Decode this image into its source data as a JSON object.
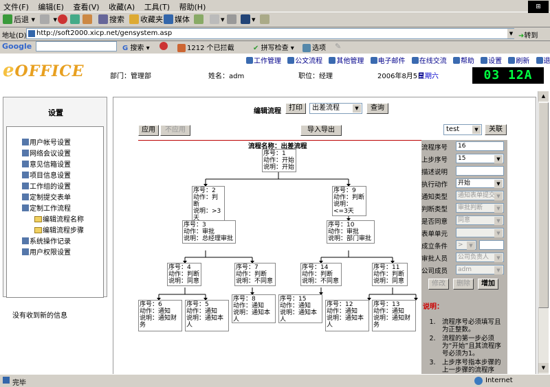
{
  "menu": {
    "items": [
      "文件(F)",
      "编辑(E)",
      "查看(V)",
      "收藏(A)",
      "工具(T)",
      "帮助(H)"
    ]
  },
  "toolbar": {
    "back": "后退",
    "search": "搜索",
    "favorites": "收藏夹",
    "media": "媒体"
  },
  "address": {
    "label": "地址(D)",
    "url": "http://soft2000.xicp.net/gensystem.asp",
    "go": "转到"
  },
  "google": {
    "label": "Google",
    "search": "搜索",
    "blocked": "1212 个已拦截",
    "spell": "拼写检查",
    "options": "选项"
  },
  "app": {
    "logo": "OFFICE",
    "nav": [
      "工作管理",
      "公文流程",
      "其他管理",
      "电子邮件",
      "在线交流",
      "帮助",
      "设置",
      "刷新",
      "退出"
    ],
    "dept": "部门：管理部",
    "name": "姓名：adm",
    "position": "职位：经理",
    "date": "2006年8月5日",
    "weekday": "星期六",
    "clock": "03 12A"
  },
  "sidebar": {
    "title": "设置",
    "items": [
      "用户帐号设置",
      "网络会议设置",
      "意见信箱设置",
      "项目信息设置",
      "工作组的设置",
      "定制提交表单",
      "定制工作流程",
      "编辑流程名称",
      "编辑流程步骤",
      "系统操作记录",
      "用户权限设置"
    ],
    "message": "没有收到新的信息"
  },
  "main": {
    "edit_label": "编辑流程",
    "print": "打印",
    "flow_select": "出差流程",
    "query": "查询",
    "apply": "应用",
    "unapply": "不应用",
    "import_export": "导入导出",
    "test_select": "test",
    "relate": "关联",
    "flow_title": "流程名称：出差流程"
  },
  "flow": {
    "n1": [
      "序号：1",
      "动作：开始",
      "说明：开始"
    ],
    "n2": [
      "序号：2",
      "动作：判断",
      "说明：>3天"
    ],
    "n9": [
      "序号：9",
      "动作：判断",
      "说明：<=3天"
    ],
    "n3": [
      "序号：3",
      "动作：审批",
      "说明：总经理审批"
    ],
    "n10": [
      "序号：10",
      "动作：审批",
      "说明：部门审批"
    ],
    "n4": [
      "序号：4",
      "动作：判断",
      "说明：同意"
    ],
    "n7": [
      "序号：7",
      "动作：判断",
      "说明：不同意"
    ],
    "n14": [
      "序号：14",
      "动作：判断",
      "说明：不同意"
    ],
    "n11": [
      "序号：11",
      "动作：判断",
      "说明：同意"
    ],
    "n6": [
      "序号：6",
      "动作：通知",
      "说明：通知财务"
    ],
    "n5": [
      "序号：5",
      "动作：通知",
      "说明：通知本人"
    ],
    "n8": [
      "序号：8",
      "动作：通知",
      "说明：通知本人"
    ],
    "n15": [
      "序号：15",
      "动作：通知",
      "说明：通知本人"
    ],
    "n12": [
      "序号：12",
      "动作：通知",
      "说明：通知本人"
    ],
    "n13": [
      "序号：13",
      "动作：通知",
      "说明：通知财务"
    ]
  },
  "panel": {
    "labels": [
      "流程序号",
      "上步序号",
      "描述说明",
      "执行动作",
      "通知类型",
      "判断类型",
      "是否同意",
      "表单单元",
      "成立条件",
      "审批人员",
      "公司成员"
    ],
    "values": [
      "16",
      "15",
      "",
      "开始",
      "通知表单提交",
      "审批判断",
      "同意",
      "",
      ">",
      "公司负责人",
      "adm"
    ],
    "modify": "修改",
    "delete": "删除",
    "add": "增加",
    "note_title": "说明：",
    "notes": [
      "流程序号必须填写且为正整数。",
      "流程的第一步必须为“开始”且其流程序号必须为1。",
      "上步序号指本步骤的上一步骤的流程序号。"
    ]
  },
  "status": {
    "done": "完毕",
    "zone": "Internet"
  }
}
